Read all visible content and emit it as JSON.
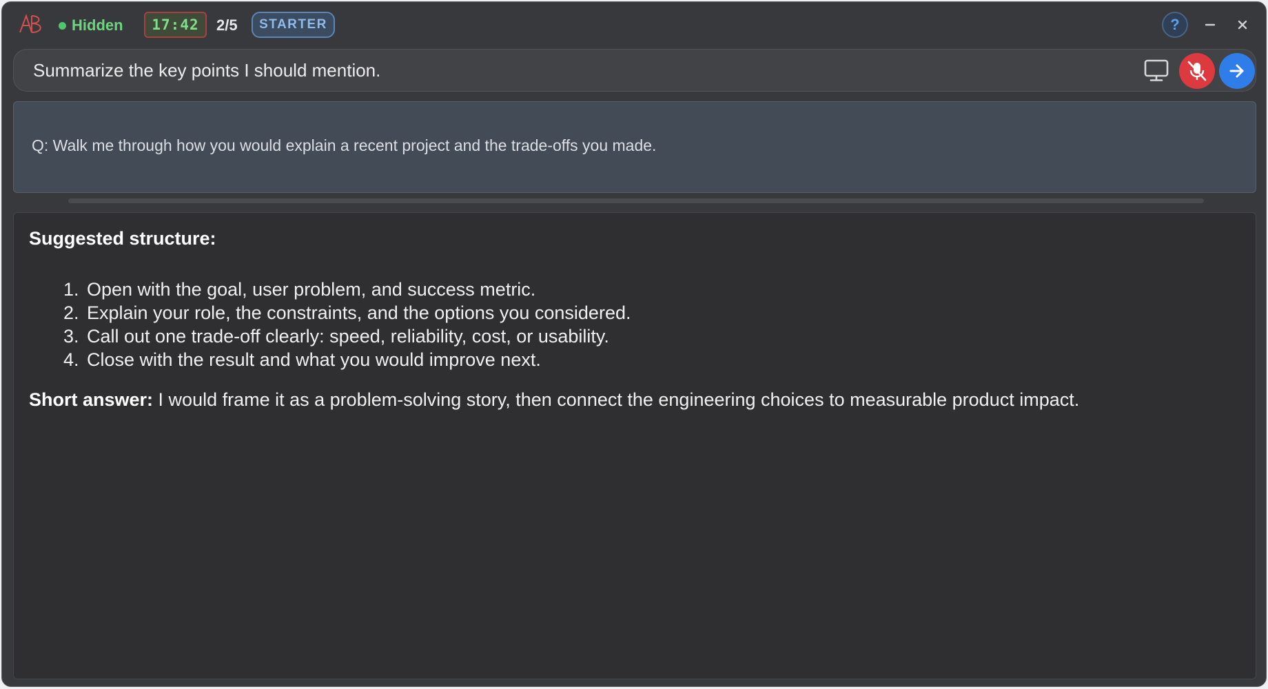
{
  "app": {
    "logo_text": "AB",
    "status_label": "Hidden",
    "timer": "17:42",
    "question_counter": "2/5",
    "plan_badge": "STARTER",
    "help_label": "?"
  },
  "input": {
    "value": "Summarize the key points I should mention.",
    "placeholder": ""
  },
  "question": {
    "text": "Q: Walk me through how you would explain a recent project and the trade-offs you made."
  },
  "answer": {
    "heading": "Suggested structure:",
    "steps": [
      "Open with the goal, user problem, and success metric.",
      "Explain your role, the constraints, and the options you considered.",
      "Call out one trade-off clearly: speed, reliability, cost, or usability.",
      "Close with the result and what you would improve next."
    ],
    "short_answer_label": "Short answer:",
    "short_answer_text": " I would frame it as a problem-solving story, then connect the engineering choices to measurable product impact."
  },
  "icons": {
    "logo": "ab-logo-icon",
    "status": "status-dot-icon",
    "help": "help-icon",
    "minimize": "minimize-icon",
    "close": "close-icon",
    "screen": "monitor-icon",
    "mic": "mic-off-icon",
    "send": "arrow-right-icon"
  },
  "colors": {
    "status_green": "#6ed57f",
    "timer_border": "#a8423f",
    "badge_blue": "#8dbbea",
    "mic_red": "#dd3a3f",
    "send_blue": "#2f7de8"
  }
}
